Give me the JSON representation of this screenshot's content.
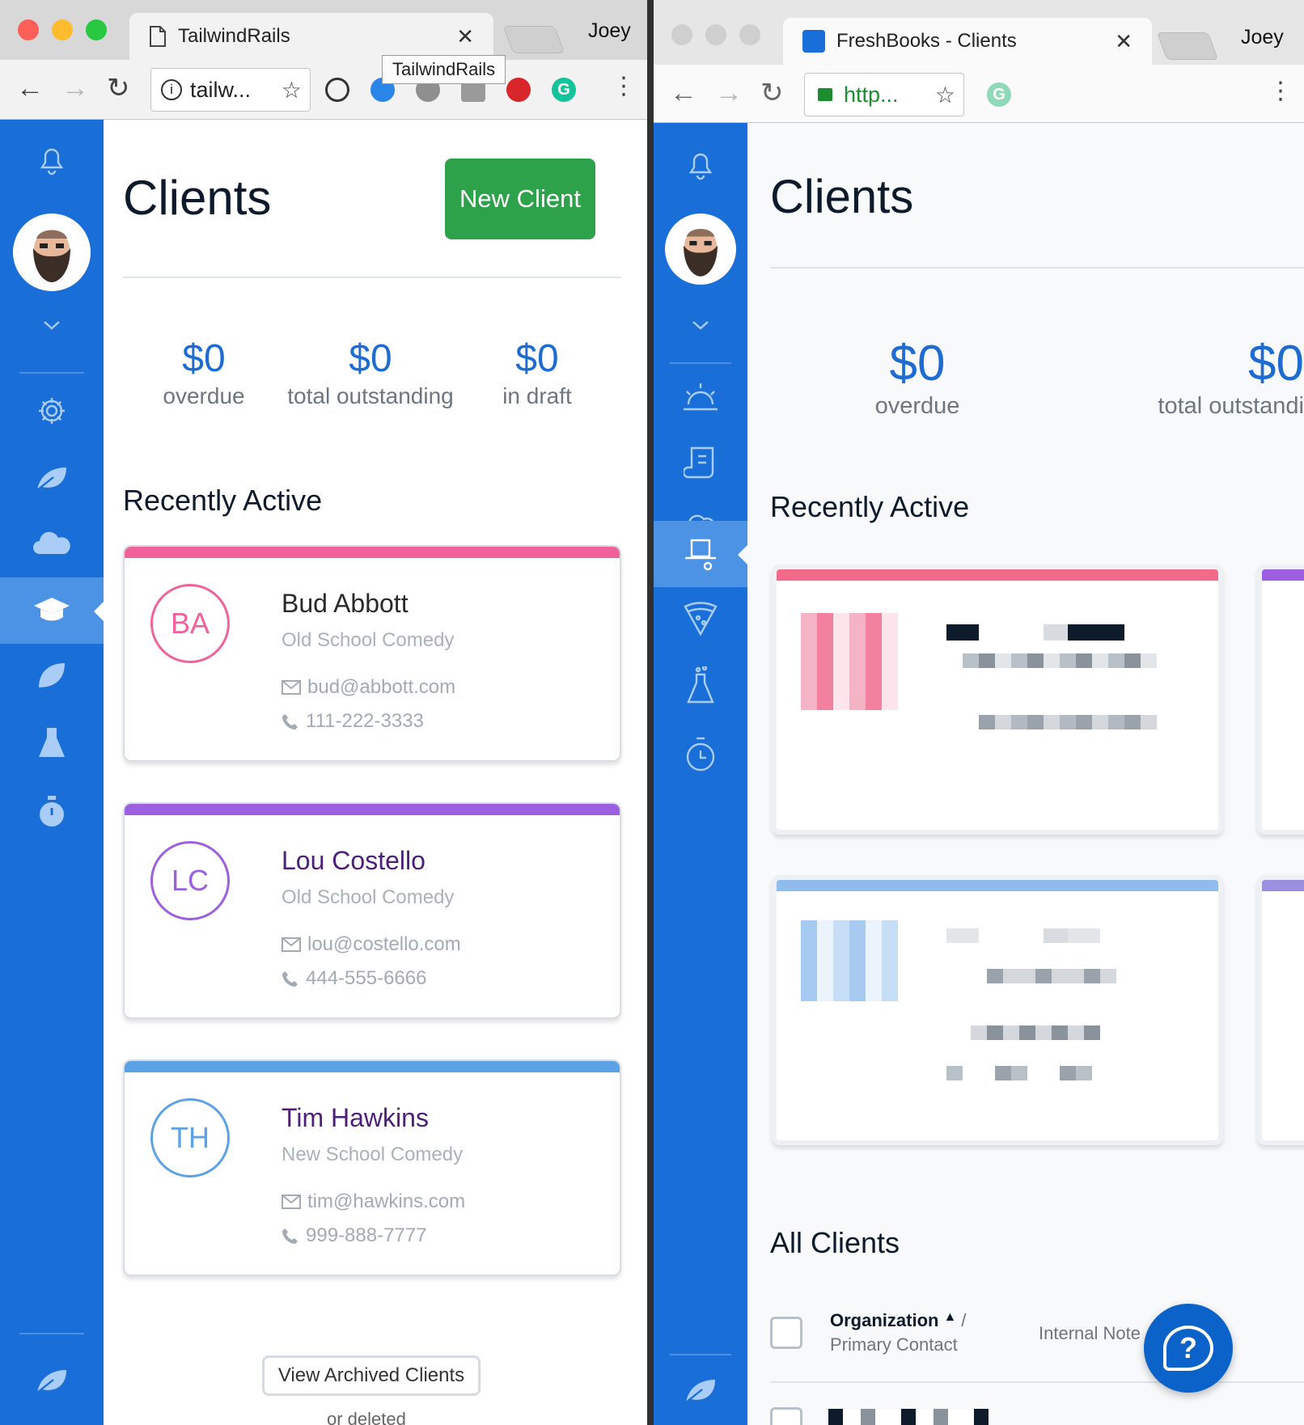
{
  "left_window": {
    "tab_title": "TailwindRails",
    "profile": "Joey",
    "omnibox_text": "tailw...",
    "tooltip": "TailwindRails",
    "page_title": "Clients",
    "new_client_button": "New Client",
    "stats": [
      {
        "value": "$0",
        "label": "overdue"
      },
      {
        "value": "$0",
        "label": "total outstanding"
      },
      {
        "value": "$0",
        "label": "in draft"
      }
    ],
    "recently_active_title": "Recently Active",
    "clients": [
      {
        "initials": "BA",
        "name": "Bud Abbott",
        "company": "Old School Comedy",
        "email": "bud@abbott.com",
        "phone": "111-222-3333",
        "color": "#f0639a"
      },
      {
        "initials": "LC",
        "name": "Lou Costello",
        "company": "Old School Comedy",
        "email": "lou@costello.com",
        "phone": "444-555-6666",
        "color": "#9b5fe0"
      },
      {
        "initials": "TH",
        "name": "Tim Hawkins",
        "company": "New School Comedy",
        "email": "tim@hawkins.com",
        "phone": "999-888-7777",
        "color": "#5ea2e6"
      }
    ],
    "view_archived_button": "View Archived Clients",
    "footer_text": "or deleted"
  },
  "right_window": {
    "tab_title": "FreshBooks - Clients",
    "profile": "Joey",
    "omnibox_text": "http...",
    "page_title": "Clients",
    "stats": [
      {
        "value": "$0",
        "label": "overdue"
      },
      {
        "value": "$0",
        "label": "total outstandi"
      }
    ],
    "recently_active_title": "Recently Active",
    "all_clients_title": "All Clients",
    "table_headers": {
      "organization": "Organization",
      "sort_glyph": "▲",
      "separator": "/",
      "primary_contact": "Primary Contact",
      "internal_note": "Internal Note"
    },
    "help_glyph": "?"
  },
  "colors": {
    "sidebar_blue": "#1a6ed8",
    "sidebar_active": "#4c93e6",
    "accent_blue": "#1e6bd1",
    "new_client_green": "#2ea24a",
    "pink": "#f0639a",
    "purple": "#9b5fe0",
    "light_blue": "#5ea2e6"
  },
  "icons": [
    "bell-icon",
    "chevron-down-icon",
    "gear-icon",
    "leaf-icon",
    "cloud-icon",
    "graduation-cap-icon",
    "flask-icon",
    "stopwatch-icon",
    "sunrise-icon",
    "scroll-icon",
    "hat-icon",
    "pizza-icon",
    "help-icon"
  ]
}
